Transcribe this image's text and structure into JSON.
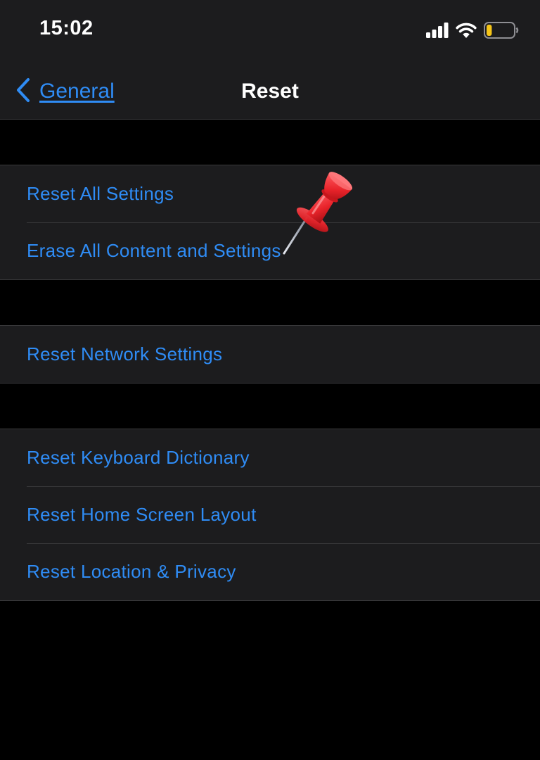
{
  "status_bar": {
    "time": "15:02",
    "icons": [
      "cellular-signal-icon",
      "wifi-icon",
      "battery-icon"
    ],
    "battery_level": 0.2,
    "battery_color": "#f5c518"
  },
  "nav": {
    "back_label": "General",
    "title": "Reset"
  },
  "colors": {
    "accent": "#2f8cf5",
    "background": "#000000",
    "cell": "#1c1c1e",
    "separator": "#38383a"
  },
  "groups": [
    {
      "rows": [
        {
          "label": "Reset All Settings"
        },
        {
          "label": "Erase All Content and Settings"
        }
      ]
    },
    {
      "rows": [
        {
          "label": "Reset Network Settings"
        }
      ]
    },
    {
      "rows": [
        {
          "label": "Reset Keyboard Dictionary"
        },
        {
          "label": "Reset Home Screen Layout"
        },
        {
          "label": "Reset Location & Privacy"
        }
      ]
    }
  ],
  "annotation": {
    "icon": "pushpin-icon",
    "color": "#e8232a"
  }
}
